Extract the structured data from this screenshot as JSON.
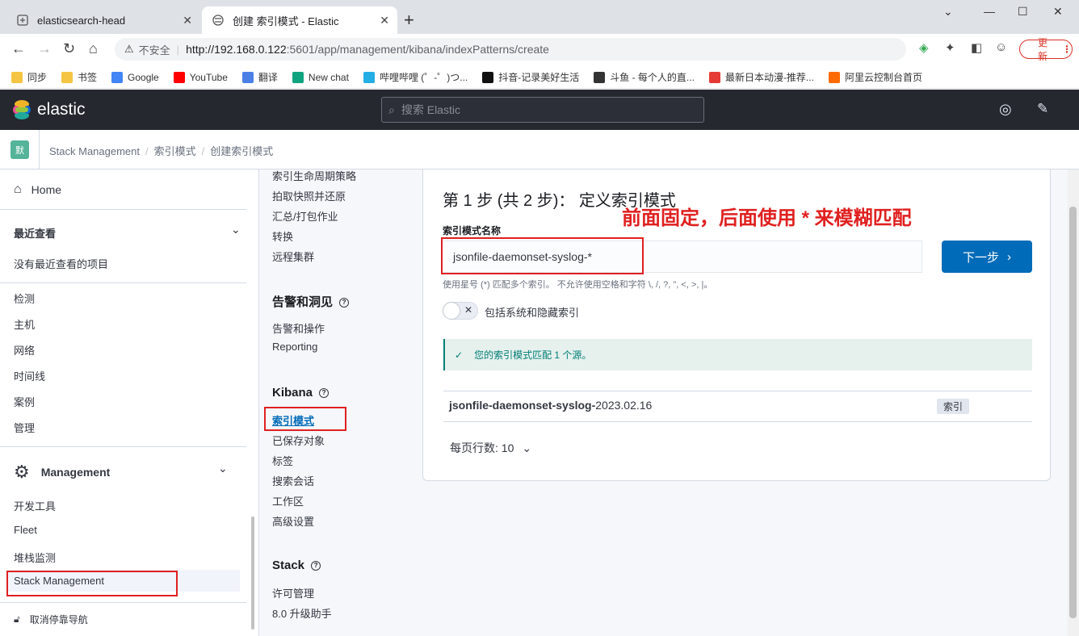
{
  "browser": {
    "tabs": [
      {
        "title": "elasticsearch-head"
      },
      {
        "title": "创建 索引模式 - Elastic"
      }
    ],
    "security_label": "不安全",
    "url_host": "http://192.168.0.122",
    "url_path": ":5601/app/management/kibana/indexPatterns/create",
    "update_label": "更新",
    "bookmarks": [
      {
        "label": "同步",
        "icon": "folder-icon",
        "color": "#f4c542"
      },
      {
        "label": "书签",
        "icon": "folder-icon",
        "color": "#f4c542"
      },
      {
        "label": "Google",
        "icon": "google-icon",
        "color": "#4285f4"
      },
      {
        "label": "YouTube",
        "icon": "youtube-icon",
        "color": "#ff0000"
      },
      {
        "label": "翻译",
        "icon": "translate-icon",
        "color": "#4a7fe6"
      },
      {
        "label": "New chat",
        "icon": "chatgpt-icon",
        "color": "#10a37f"
      },
      {
        "label": "哔哩哔哩 (゜-゜)つ...",
        "icon": "bilibili-icon",
        "color": "#23ade5"
      },
      {
        "label": "抖音-记录美好生活",
        "icon": "tiktok-icon",
        "color": "#111111"
      },
      {
        "label": "斗鱼 - 每个人的直...",
        "icon": "douyu-icon",
        "color": "#333333"
      },
      {
        "label": "最新日本动漫-推荐...",
        "icon": "play-icon",
        "color": "#e53935"
      },
      {
        "label": "阿里云控制台首页",
        "icon": "aliyun-icon",
        "color": "#ff6a00"
      }
    ]
  },
  "kibana": {
    "logo_text": "elastic",
    "search_placeholder": "搜索 Elastic",
    "space_badge": "默",
    "breadcrumbs": [
      "Stack Management",
      "索引模式",
      "创建索引模式"
    ]
  },
  "leftnav": {
    "home": "Home",
    "recent_title": "最近查看",
    "recent_empty": "没有最近查看的项目",
    "items": [
      "检测",
      "主机",
      "网络",
      "时间线",
      "案例",
      "管理"
    ],
    "management_title": "Management",
    "management_items": [
      "开发工具",
      "Fleet",
      "堆栈监测",
      "Stack Management"
    ],
    "undock": "取消停靠导航"
  },
  "sidenav": {
    "data_items": [
      "索引生命周期策略",
      "拍取快照并还原",
      "汇总/打包作业",
      "转换",
      "远程集群"
    ],
    "alerts_title": "告警和洞见",
    "alerts_items": [
      "告警和操作",
      "Reporting"
    ],
    "kibana_title": "Kibana",
    "kibana_items": [
      "索引模式",
      "已保存对象",
      "标签",
      "搜索会话",
      "工作区",
      "高级设置"
    ],
    "stack_title": "Stack",
    "stack_items": [
      "许可管理",
      "8.0 升级助手"
    ]
  },
  "form": {
    "step_title": "第 1 步 (共 2 步)： 定义索引模式",
    "field_label": "索引模式名称",
    "input_value": "jsonfile-daemonset-syslog-*",
    "help_text": "使用星号 (*) 匹配多个索引。 不允许使用空格和字符 \\, /, ?, \", <, >, |。",
    "next_button": "下一步",
    "include_hidden_label": "包括系统和隐藏索引",
    "success_callout": "您的索引模式匹配 1 个源。",
    "match_row": {
      "name_bold": "jsonfile-daemonset-syslog-",
      "name_rest": "2023.02.16",
      "badge": "索引"
    },
    "rows_per_page_label": "每页行数: 10"
  },
  "annotation": {
    "text": "前面固定，后面使用 * 来模糊匹配",
    "color": "#e02020"
  },
  "colors": {
    "accent": "#006bb8",
    "success": "#017d73",
    "header_bg": "#25282f"
  }
}
